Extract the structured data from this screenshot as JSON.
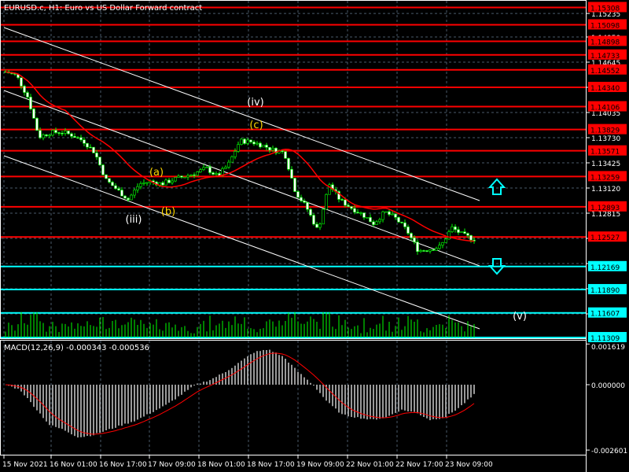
{
  "title": "EURUSD.c, H1:  Euro vs US Dollar Forward contract",
  "macd_label": "MACD(12,26,9) -0.000343 -0.000536",
  "colors": {
    "bg": "#000000",
    "axis": "#ffffff",
    "grid": "#4a5a6a",
    "resistance": "#ff0000",
    "support": "#00ffff",
    "candle": "#00ff00",
    "ma": "#ff0000",
    "macd_hist": "#c0c0c0",
    "signal": "#ff0000",
    "wave_primary": "#ffffff",
    "wave_minor": "#ffd700"
  },
  "chart_data": [
    {
      "type": "candlestick",
      "symbol": "EURUSD.c",
      "timeframe": "H1",
      "ylim": [
        1.1128,
        1.1535
      ],
      "price_ticks": [
        "1.15235",
        "1.14950",
        "1.14645",
        "1.14340",
        "1.14035",
        "1.13730",
        "1.13425",
        "1.13120",
        "1.12815",
        "1.12510",
        "1.12205",
        "1.11900",
        "1.11595"
      ],
      "time_labels": [
        "15 Nov 2021",
        "16 Nov 01:00",
        "16 Nov 17:00",
        "17 Nov 09:00",
        "18 Nov 01:00",
        "18 Nov 17:00",
        "19 Nov 09:00",
        "22 Nov 01:00",
        "22 Nov 17:00",
        "23 Nov 09:00"
      ],
      "close_path": [
        1.1453,
        1.1448,
        1.1422,
        1.1374,
        1.1379,
        1.138,
        1.1376,
        1.1369,
        1.1355,
        1.1322,
        1.131,
        1.1298,
        1.1317,
        1.132,
        1.1317,
        1.1322,
        1.1326,
        1.133,
        1.1336,
        1.1326,
        1.1341,
        1.1369,
        1.1368,
        1.1364,
        1.1358,
        1.1355,
        1.1307,
        1.1288,
        1.126,
        1.1317,
        1.1297,
        1.1288,
        1.128,
        1.1269,
        1.1283,
        1.1275,
        1.126,
        1.1236,
        1.1238,
        1.1241,
        1.1264,
        1.1255,
        1.125
      ],
      "resistance_levels": [
        "1.15308",
        "1.15098",
        "1.14898",
        "1.14733",
        "1.14552",
        "1.14340",
        "1.14106",
        "1.13829",
        "1.13571",
        "1.13259",
        "1.12893",
        "1.12527"
      ],
      "support_levels": [
        "1.12169",
        "1.11890",
        "1.11607",
        "1.11309"
      ],
      "wave_labels": [
        {
          "text": "(iii)",
          "kind": "primary"
        },
        {
          "text": "(a)",
          "kind": "minor"
        },
        {
          "text": "(b)",
          "kind": "minor"
        },
        {
          "text": "(iv)",
          "kind": "primary"
        },
        {
          "text": "(c)",
          "kind": "minor"
        },
        {
          "text": "(v)",
          "kind": "primary"
        }
      ]
    },
    {
      "type": "bar",
      "name": "MACD(12,26,9)",
      "ylim": [
        -0.002601,
        0.001619
      ],
      "ticks": [
        "0.001619",
        "0.000000",
        "-0.002601"
      ],
      "main_value": -0.000343,
      "signal_value": -0.000536,
      "histogram_path": [
        0,
        -0.0002,
        -0.0009,
        -0.0016,
        -0.0018,
        -0.0021,
        -0.002,
        -0.0018,
        -0.0016,
        -0.0014,
        -0.0011,
        -0.0008,
        -0.0004,
        0,
        0.0002,
        0.0005,
        0.0009,
        0.0013,
        0.0014,
        0.0011,
        0.0005,
        0,
        -0.0007,
        -0.0012,
        -0.0013,
        -0.0014,
        -0.0013,
        -0.001,
        -0.0011,
        -0.0014,
        -0.0013,
        -0.0009,
        -0.0004
      ]
    }
  ]
}
